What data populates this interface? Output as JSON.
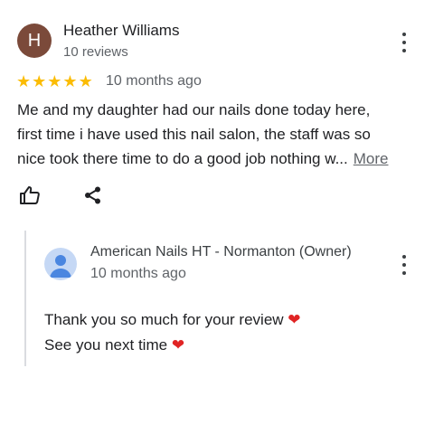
{
  "review": {
    "avatar_initial": "H",
    "author": "Heather Williams",
    "reviews_count": "10 reviews",
    "rating": 5,
    "stars": "★★★★★",
    "time": "10 months ago",
    "lines": [
      "Me and my daughter had our nails done today here,",
      "first time i have used this nail salon, the staff was so",
      "nice took there time to do a good job nothing w..."
    ],
    "more_label": "More",
    "icons": {
      "menu": "more-vert-icon",
      "like": "thumbs-up-icon",
      "share": "share-icon"
    }
  },
  "owner_reply": {
    "owner_name": "American Nails HT - Normanton (Owner)",
    "time": "10 months ago",
    "lines": [
      "Thank you so much for your review",
      "See you next time"
    ],
    "heart": "❤",
    "icons": {
      "avatar": "person-icon",
      "menu": "more-vert-icon"
    }
  },
  "colors": {
    "star": "#fbbc04",
    "avatar_bg": "#7b4a3a",
    "heart": "#e02424"
  }
}
